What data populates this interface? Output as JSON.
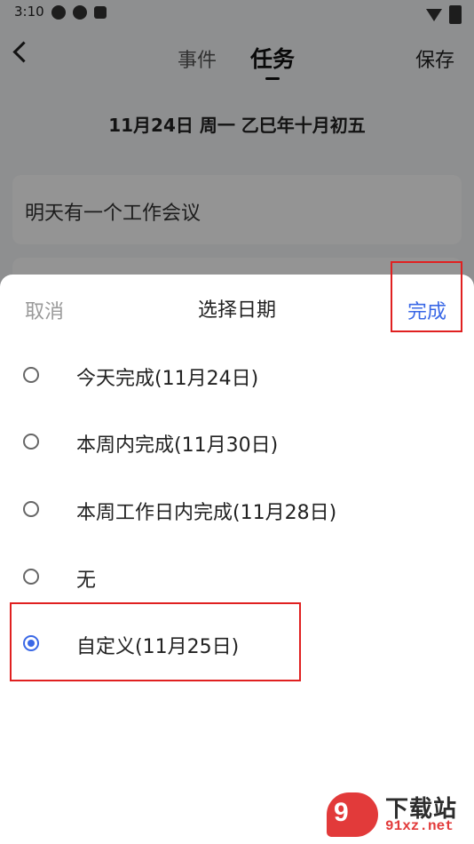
{
  "status_bar": {
    "time": "3:10"
  },
  "header": {
    "tab_event": "事件",
    "tab_task": "任务",
    "save_label": "保存"
  },
  "date_line": "11月24日 周一 乙巳年十月初五",
  "task_input_value": "明天有一个工作会议",
  "sheet": {
    "cancel_label": "取消",
    "title": "选择日期",
    "done_label": "完成",
    "options": [
      {
        "label": "今天完成(11月24日)",
        "selected": false
      },
      {
        "label": "本周内完成(11月30日)",
        "selected": false
      },
      {
        "label": "本周工作日内完成(11月28日)",
        "selected": false
      },
      {
        "label": "无",
        "selected": false
      },
      {
        "label": "自定义(11月25日)",
        "selected": true
      }
    ]
  },
  "watermark": {
    "logo_text": "9",
    "title": "下载站",
    "domain": "91xz.net"
  },
  "colors": {
    "accent": "#3a68e6",
    "highlight": "#e02020",
    "watermark_red": "#e23a3a"
  }
}
